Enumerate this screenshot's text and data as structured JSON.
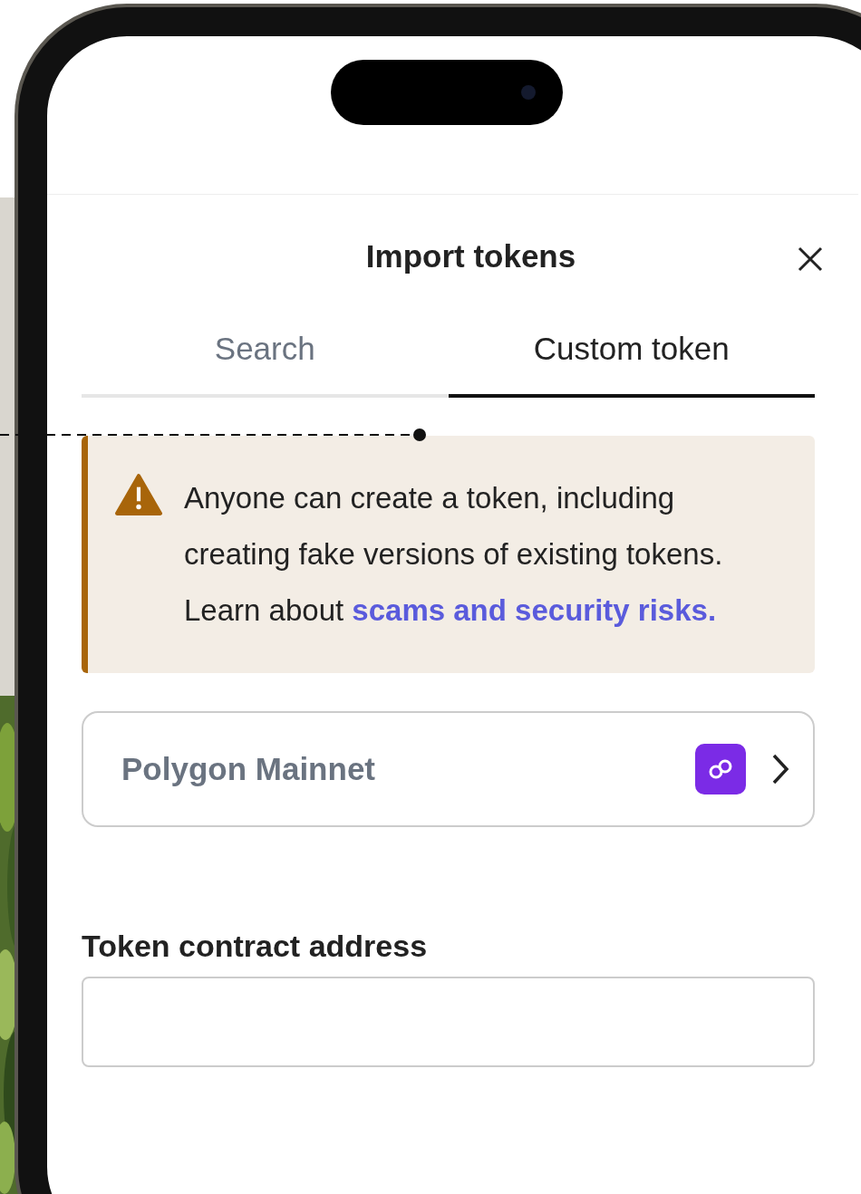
{
  "modal": {
    "title": "Import tokens"
  },
  "tabs": [
    {
      "label": "Search",
      "selected": false
    },
    {
      "label": "Custom token",
      "selected": true
    }
  ],
  "warning": {
    "text": "Anyone can create a token, including creating fake versions of existing tokens. Learn about",
    "link": "scams and security risks."
  },
  "network": {
    "name": "Polygon Mainnet"
  },
  "field": {
    "label": "Token contract address"
  }
}
